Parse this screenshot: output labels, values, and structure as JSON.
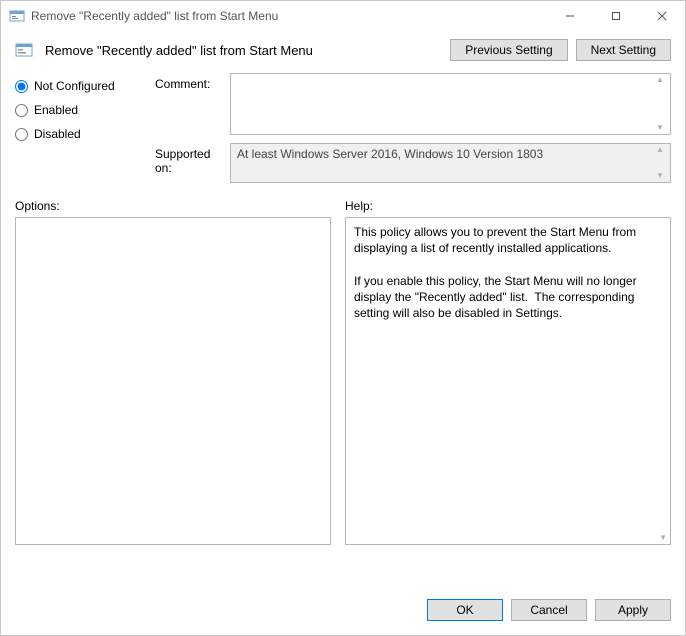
{
  "window": {
    "title": "Remove \"Recently added\" list from Start Menu"
  },
  "header": {
    "title": "Remove \"Recently added\" list from Start Menu",
    "prev_label": "Previous Setting",
    "next_label": "Next Setting"
  },
  "state": {
    "options": [
      {
        "label": "Not Configured",
        "selected": true
      },
      {
        "label": "Enabled",
        "selected": false
      },
      {
        "label": "Disabled",
        "selected": false
      }
    ]
  },
  "labels": {
    "comment": "Comment:",
    "supported": "Supported on:",
    "options": "Options:",
    "help": "Help:"
  },
  "comment_value": "",
  "supported_value": "At least Windows Server 2016, Windows 10 Version 1803",
  "help_text": "This policy allows you to prevent the Start Menu from displaying a list of recently installed applications.\n\nIf you enable this policy, the Start Menu will no longer display the \"Recently added\" list.  The corresponding setting will also be disabled in Settings.",
  "footer": {
    "ok": "OK",
    "cancel": "Cancel",
    "apply": "Apply"
  }
}
